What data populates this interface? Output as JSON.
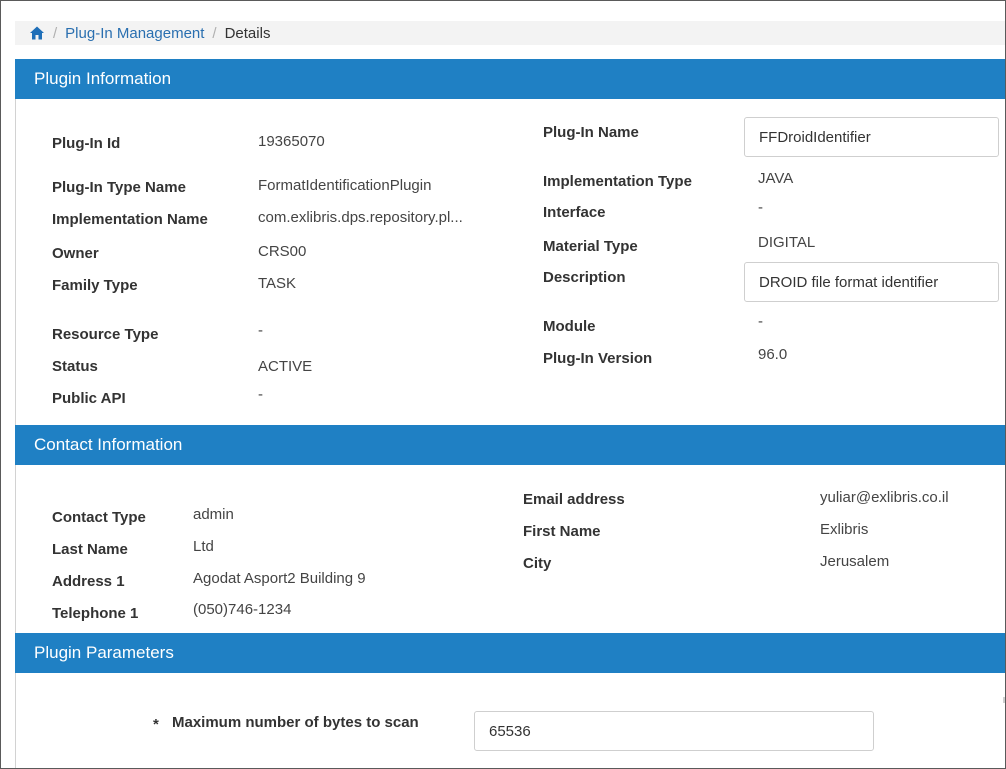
{
  "breadcrumb": {
    "home_icon": "home-icon",
    "items": [
      "Plug-In Management",
      "Details"
    ]
  },
  "plugin_info": {
    "header": "Plugin Information",
    "plugin_id_label": "Plug-In Id",
    "plugin_id": "19365070",
    "type_name_label": "Plug-In Type Name",
    "type_name": "FormatIdentificationPlugin",
    "impl_name_label": "Implementation Name",
    "impl_name": "com.exlibris.dps.repository.pl...",
    "owner_label": "Owner",
    "owner": "CRS00",
    "family_type_label": "Family Type",
    "family_type": "TASK",
    "resource_type_label": "Resource Type",
    "resource_type": "-",
    "status_label": "Status",
    "status": "ACTIVE",
    "public_api_label": "Public API",
    "public_api": "-",
    "plugin_name_label": "Plug-In Name",
    "plugin_name": "FFDroidIdentifier",
    "impl_type_label": "Implementation Type",
    "impl_type": "JAVA",
    "interface_label": "Interface",
    "interface": "-",
    "material_type_label": "Material Type",
    "material_type": "DIGITAL",
    "description_label": "Description",
    "description": "DROID file format identifier",
    "module_label": "Module",
    "module": "-",
    "version_label": "Plug-In Version",
    "version": "96.0"
  },
  "contact_info": {
    "header": "Contact Information",
    "contact_type_label": "Contact Type",
    "contact_type": "admin",
    "last_name_label": "Last Name",
    "last_name": "Ltd",
    "address1_label": "Address 1",
    "address1": "Agodat Asport2 Building 9",
    "telephone1_label": "Telephone 1",
    "telephone1": "(050)746-1234",
    "email_label": "Email address",
    "email": "yuliar@exlibris.co.il",
    "first_name_label": "First Name",
    "first_name": "Exlibris",
    "city_label": "City",
    "city": "Jerusalem"
  },
  "plugin_params": {
    "header": "Plugin Parameters",
    "required_mark": "*",
    "max_bytes_label": "Maximum number of bytes to scan",
    "max_bytes": "65536"
  },
  "colors": {
    "header_blue": "#1f80c4",
    "link_blue": "#2a6fb0"
  }
}
